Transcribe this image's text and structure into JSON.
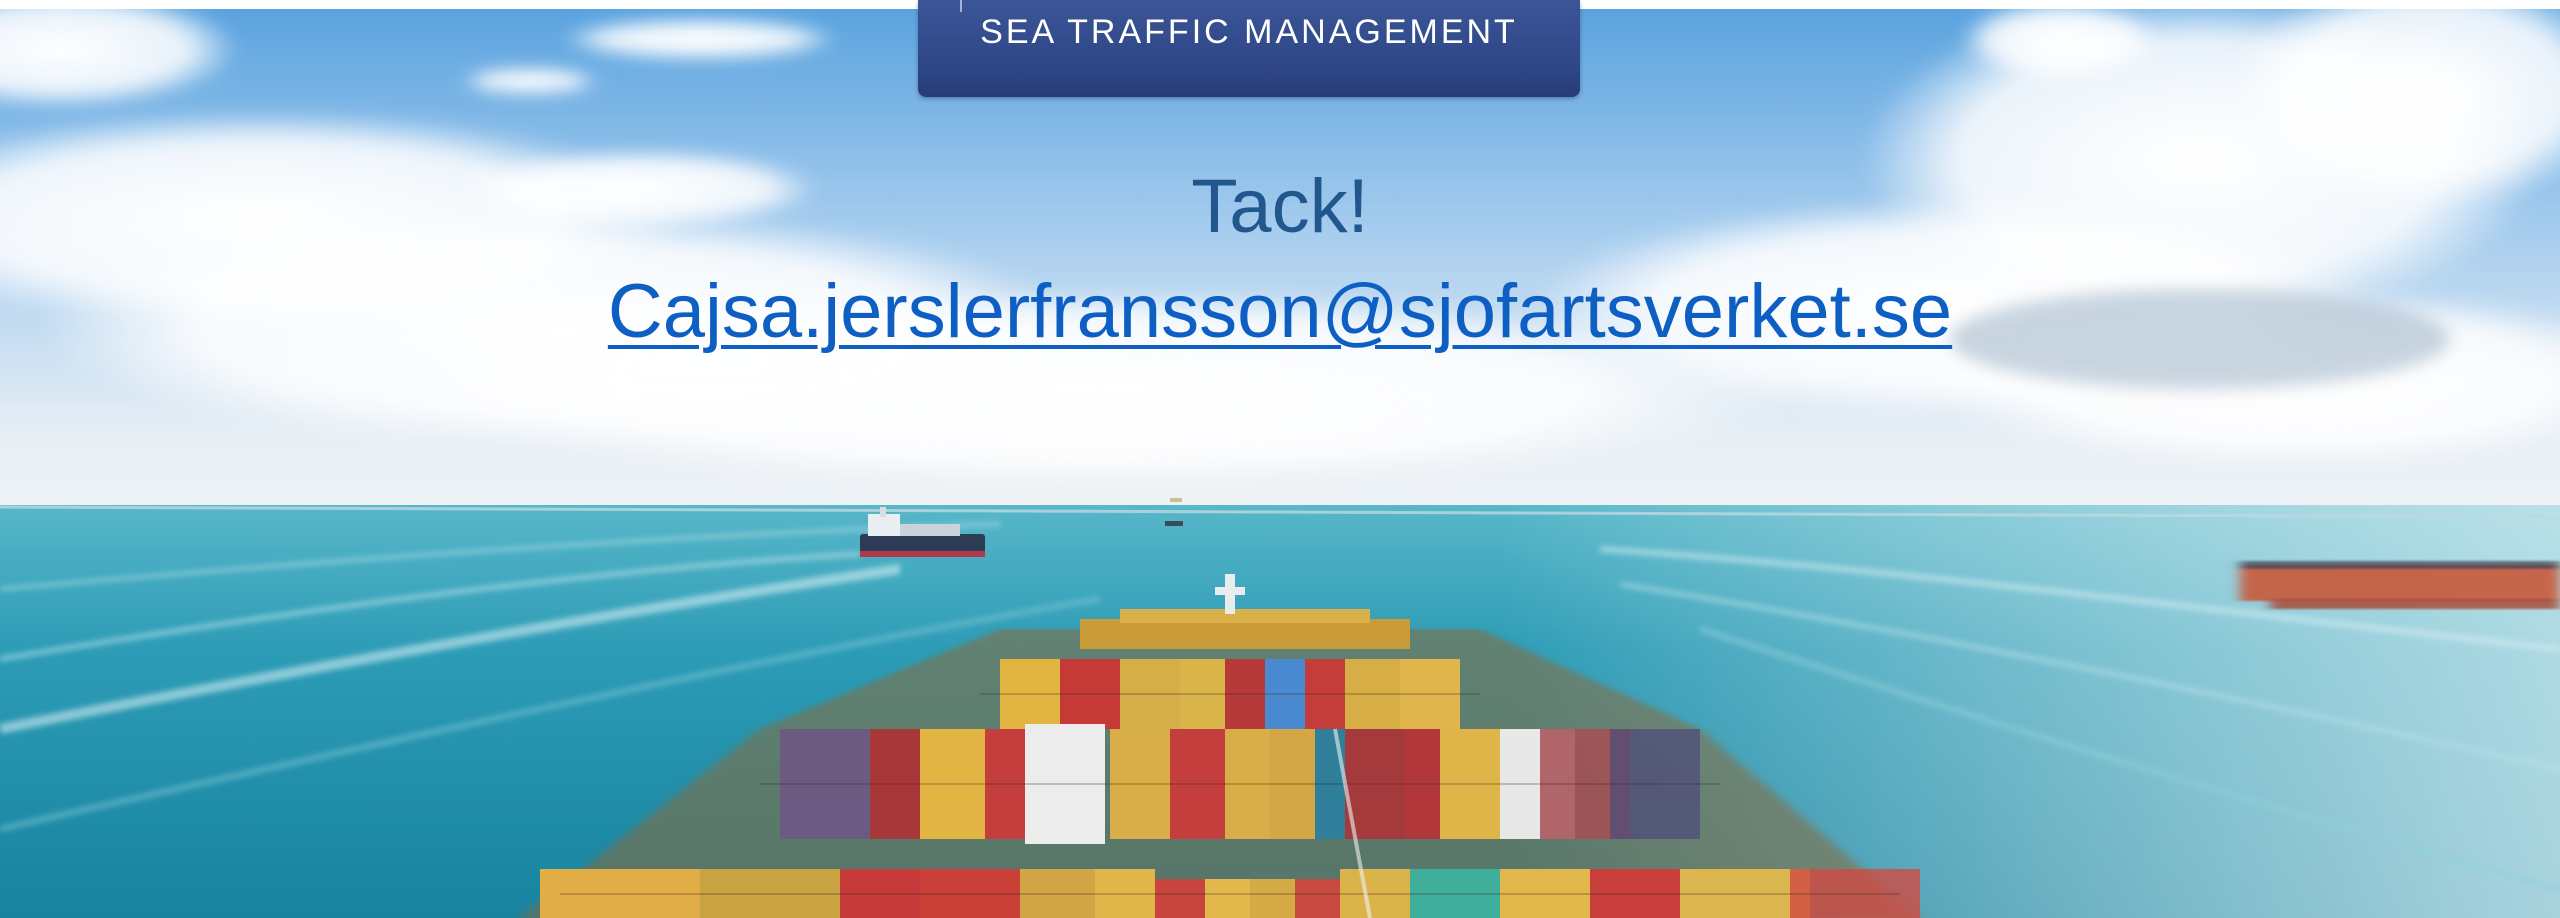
{
  "banner": {
    "text": "SEA TRAFFIC MANAGEMENT"
  },
  "slide": {
    "thanks": "Tack!",
    "email": "Cajsa.jerslerfransson@sjofartsverket.se"
  },
  "colors": {
    "banner_bg": "#2e4686",
    "thanks_text": "#22578e",
    "email_link": "#0e5fc3",
    "sky_top": "#5fa6e0",
    "sea": "#2a97b3"
  }
}
